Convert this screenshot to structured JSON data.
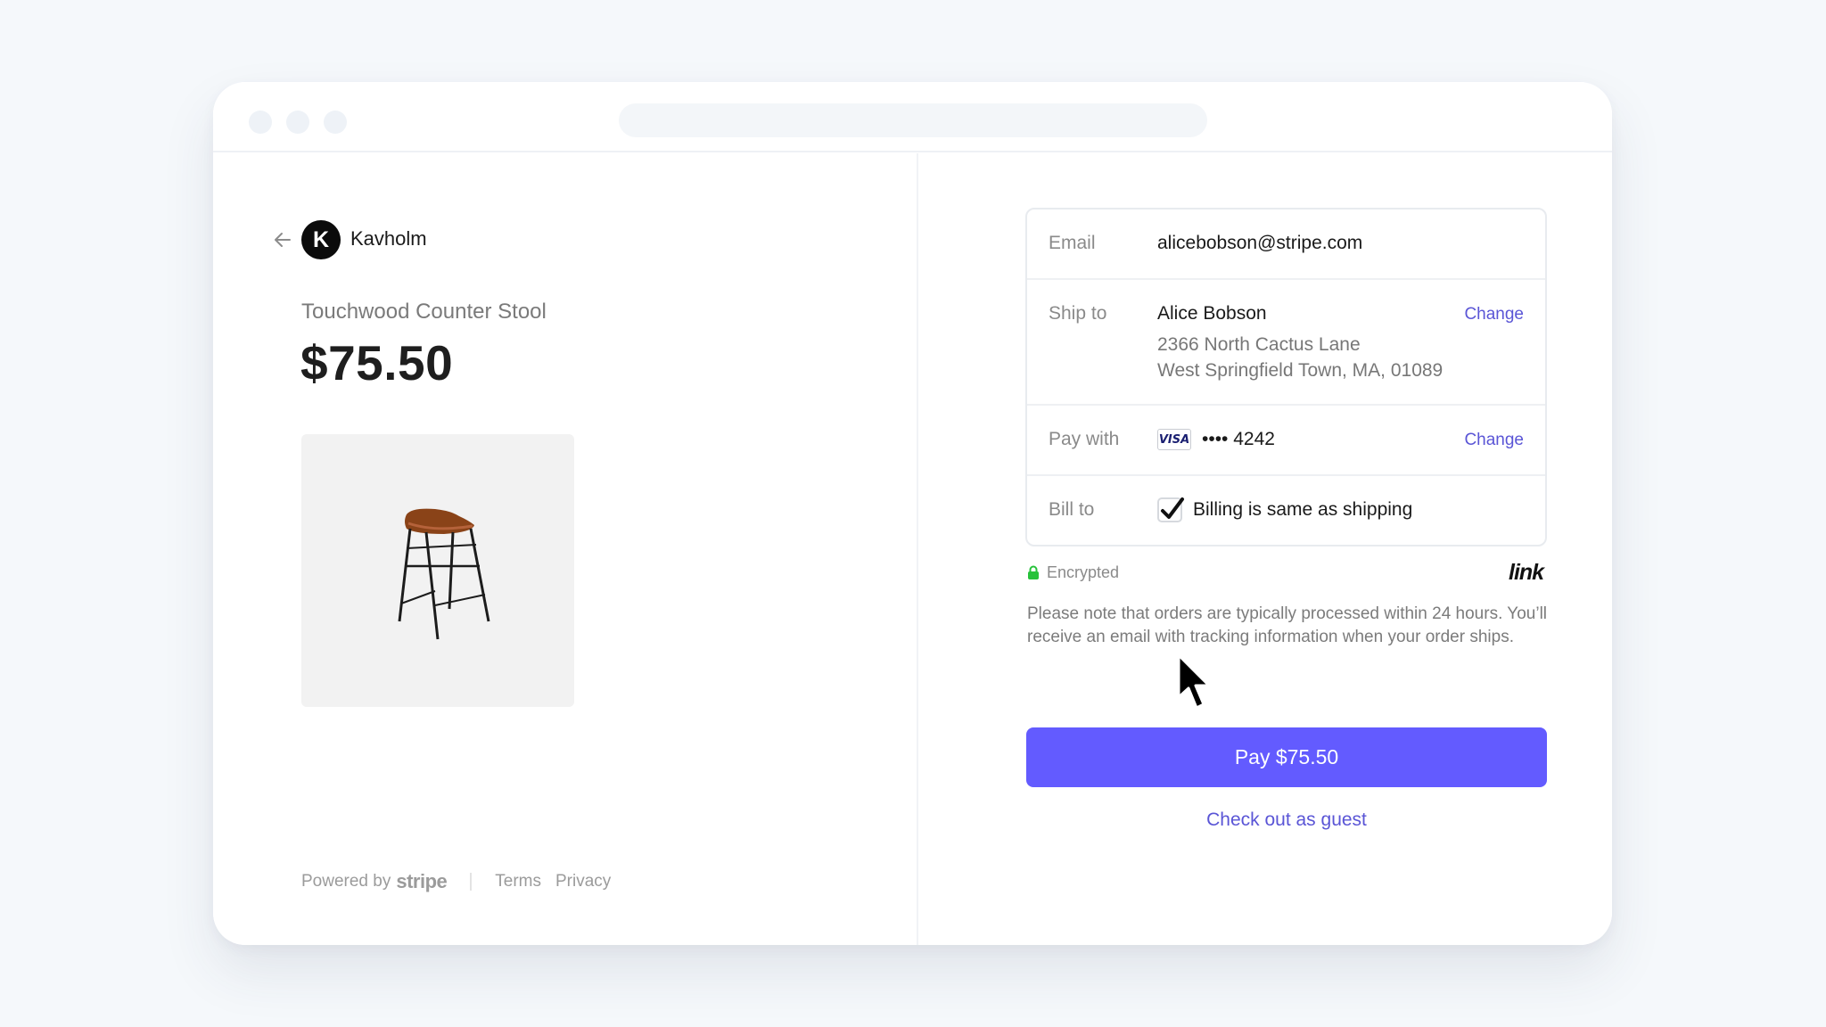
{
  "merchant": {
    "logo_letter": "K",
    "name": "Kavholm"
  },
  "product": {
    "name": "Touchwood Counter Stool",
    "price": "$75.50"
  },
  "footer": {
    "powered_by": "Powered by",
    "stripe": "stripe",
    "terms": "Terms",
    "privacy": "Privacy"
  },
  "form": {
    "email": {
      "label": "Email",
      "value": "alicebobson@stripe.com"
    },
    "ship_to": {
      "label": "Ship to",
      "name": "Alice Bobson",
      "address_line1": "2366 North Cactus Lane",
      "address_line2": "West Springfield Town, MA, 01089",
      "change": "Change"
    },
    "pay_with": {
      "label": "Pay with",
      "card_brand": "VISA",
      "card_number": "•••• 4242",
      "change": "Change"
    },
    "bill_to": {
      "label": "Bill to",
      "checkbox_label": "Billing is same as shipping",
      "checked": true
    }
  },
  "security": {
    "encrypted": "Encrypted",
    "link_logo": "link"
  },
  "note": "Please note that orders are typically processed within 24 hours. You’ll receive an email with tracking information when your order ships.",
  "actions": {
    "pay": "Pay $75.50",
    "guest": "Check out as guest"
  },
  "colors": {
    "accent": "#635bff",
    "link": "#5a55d6",
    "lock": "#27c23a"
  },
  "icons": {
    "back": "arrow-left-icon",
    "lock": "lock-icon",
    "check": "checkmark-icon",
    "cursor": "mouse-pointer-icon"
  }
}
